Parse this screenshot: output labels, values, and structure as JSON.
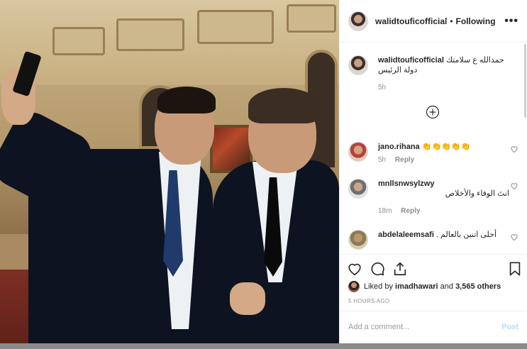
{
  "post": {
    "username": "walidtouficofficial",
    "separator": "•",
    "follow_status": "Following",
    "more_icon": "more-horizontal-icon"
  },
  "comments": [
    {
      "username": "walidtouficofficial",
      "text": "حمدالله ع سلامتك دولة الرئيس",
      "time": "5h",
      "reply": ""
    },
    {
      "username": "jano.rihana",
      "text": "👏👏👏👏👏",
      "time": "5h",
      "reply": "Reply"
    },
    {
      "username": "mnllsnwsylzwy",
      "text": "انتَ الوفاء والأخلاص",
      "time": "18m",
      "reply": "Reply"
    },
    {
      "username": "abdelaleemsafi",
      "text": "أحلى اتنين بالعالم .",
      "time": "",
      "reply": ""
    }
  ],
  "likes": {
    "prefix": "Liked by",
    "user": "imadhawari",
    "middle": "and",
    "others": "3,565 others"
  },
  "timestamp": "5 HOURS AGO",
  "comment_box": {
    "placeholder": "Add a comment...",
    "post_label": "Post"
  },
  "colors": {
    "accent_disabled": "#b2dffc",
    "secondary_text": "#8e8e8e",
    "border": "#efefef"
  }
}
